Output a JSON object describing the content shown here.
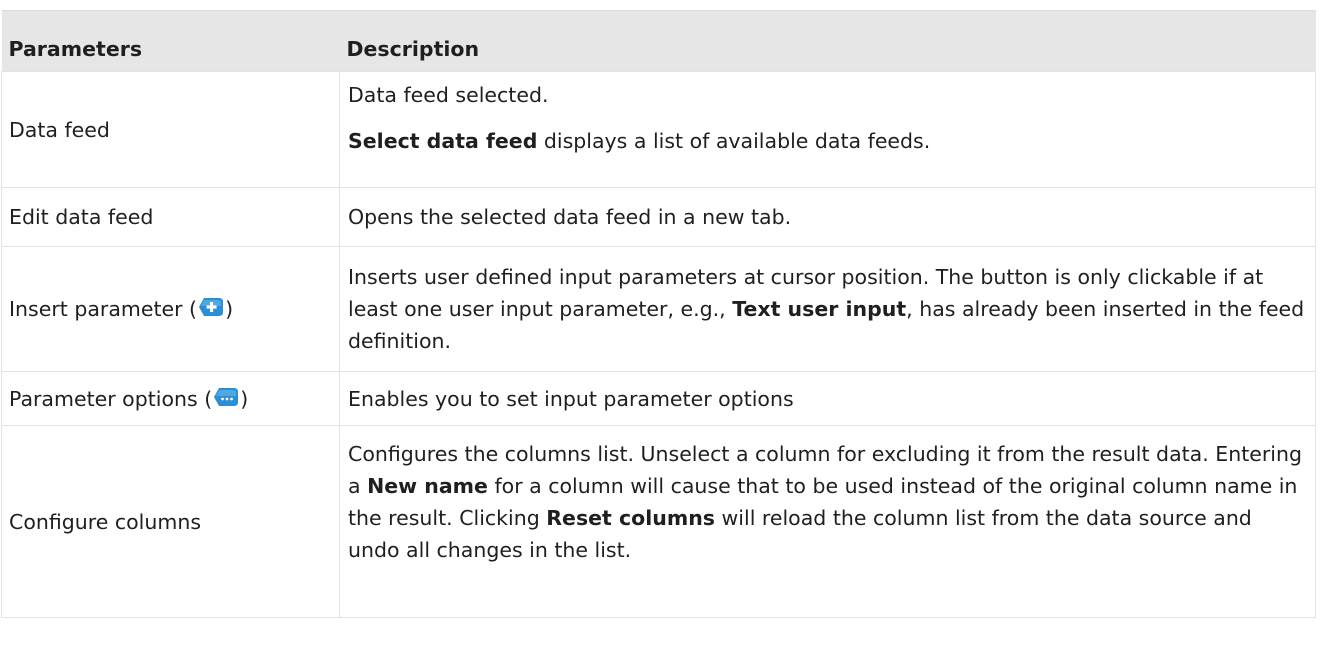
{
  "headers": {
    "parameters": "Parameters",
    "description": "Description"
  },
  "rows": [
    {
      "param": "Data feed",
      "desc_line1": "Data feed selected.",
      "desc_bold": "Select data feed",
      "desc_rest": " displays a list of available data feeds."
    },
    {
      "param": "Edit data feed",
      "desc": "Opens the selected data feed in a new tab."
    },
    {
      "param_prefix": "Insert parameter (",
      "param_suffix": ")",
      "icon": "add-parameter-icon",
      "desc_a": "Inserts user defined input parameters at cursor position. The button is only clickable if at least one user input parameter, e.g., ",
      "desc_bold": "Text user input",
      "desc_b": ", has already been inserted in the feed definition."
    },
    {
      "param_prefix": "Parameter options (",
      "param_suffix": ")",
      "icon": "parameter-options-icon",
      "desc": "Enables you to set input parameter options"
    },
    {
      "param": "Configure columns",
      "desc_a": "Configures the columns list. Unselect a column for excluding it from the result data. Entering a ",
      "desc_bold1": "New name",
      "desc_b": " for a column will cause that to be used instead of the original column name in the result. Clicking ",
      "desc_bold2": "Reset columns",
      "desc_c": " will reload the column list from the data source and undo all changes in the list."
    }
  ],
  "colors": {
    "header_bg": "#e6e6e6",
    "icon_blue": "#2a8fd4"
  }
}
